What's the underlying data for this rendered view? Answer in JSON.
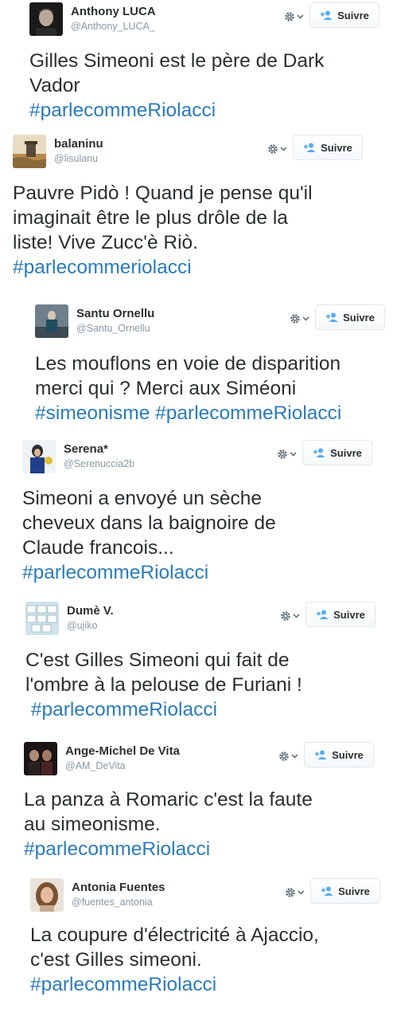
{
  "tweets": [
    {
      "name": "Anthony LUCA",
      "handle": "@Anthony_LUCA_",
      "follow_label": "Suivre",
      "lines": [
        [
          {
            "text": "Gilles Simeoni est le père de Dark"
          }
        ],
        [
          {
            "text": "Vador"
          }
        ],
        [
          {
            "text": "#parlecommeRiolacci",
            "hashtag": true
          }
        ]
      ]
    },
    {
      "name": "balaninu",
      "handle": "@lisulanu",
      "follow_label": "Suivre",
      "lines": [
        [
          {
            "text": "Pauvre Pidò ! Quand je pense qu'il"
          }
        ],
        [
          {
            "text": "imaginait être le plus drôle de la"
          }
        ],
        [
          {
            "text": "liste! Vive Zucc'è Riò."
          }
        ],
        [
          {
            "text": "#parlecommeriolacci",
            "hashtag": true
          }
        ]
      ]
    },
    {
      "name": "Santu Ornellu",
      "handle": "@Santu_Ornellu",
      "follow_label": "Suivre",
      "lines": [
        [
          {
            "text": "Les mouflons en voie de disparition"
          }
        ],
        [
          {
            "text": "merci qui ? Merci aux Siméoni"
          }
        ],
        [
          {
            "text": "#simeonisme",
            "hashtag": true
          },
          {
            "text": " "
          },
          {
            "text": "#parlecommeRiolacci",
            "hashtag": true
          }
        ]
      ]
    },
    {
      "name": "Serena*",
      "handle": "@Serenuccia2b",
      "follow_label": "Suivre",
      "lines": [
        [
          {
            "text": "Simeoni a envoyé un sèche"
          }
        ],
        [
          {
            "text": "cheveux dans la baignoire de"
          }
        ],
        [
          {
            "text": "Claude francois..."
          }
        ],
        [
          {
            "text": "#parlecommeRiolacci",
            "hashtag": true
          }
        ]
      ]
    },
    {
      "name": "Dumè V.",
      "handle": "@ujiko",
      "follow_label": "Suivre",
      "lines": [
        [
          {
            "text": "C'est Gilles Simeoni qui fait de"
          }
        ],
        [
          {
            "text": "l'ombre à la pelouse de Furiani !"
          }
        ],
        [
          {
            "text": " "
          },
          {
            "text": "#parlecommeRiolacci",
            "hashtag": true
          }
        ]
      ]
    },
    {
      "name": "Ange-Michel De Vita",
      "handle": "@AM_DeVita",
      "follow_label": "Suivre",
      "lines": [
        [
          {
            "text": "La panza à Romaric c'est la faute"
          }
        ],
        [
          {
            "text": "au simeonisme."
          }
        ],
        [
          {
            "text": "#parlecommeRiolacci",
            "hashtag": true
          }
        ]
      ]
    },
    {
      "name": "Antonia Fuentes",
      "handle": "@fuentes_antonia",
      "follow_label": "Suivre",
      "lines": [
        [
          {
            "text": "La coupure d'électricité à Ajaccio,"
          }
        ],
        [
          {
            "text": "c'est Gilles simeoni."
          }
        ],
        [
          {
            "text": "#parlecommeRiolacci",
            "hashtag": true
          }
        ]
      ]
    }
  ],
  "icons": {
    "gear": "gear-icon",
    "caret": "caret-down-icon",
    "follow": "follow-user-icon"
  },
  "colors": {
    "text": "#292f33",
    "hashtag": "#2b7bb9",
    "handle": "#8899a6",
    "follow_icon": "#55acee"
  }
}
